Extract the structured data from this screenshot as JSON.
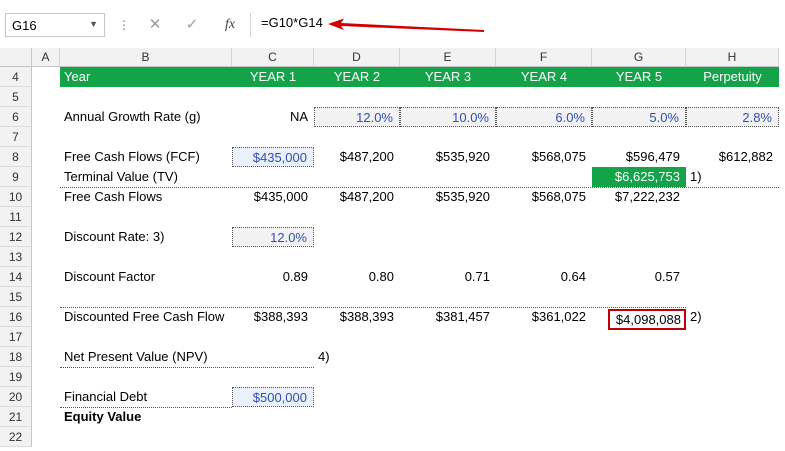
{
  "formula_bar": {
    "name_box": "G16",
    "cancel_icon": "✕",
    "enter_icon": "✓",
    "fx_label": "fx",
    "formula": "=G10*G14"
  },
  "columns": [
    "A",
    "B",
    "C",
    "D",
    "E",
    "F",
    "G",
    "H"
  ],
  "rows": [
    "4",
    "5",
    "6",
    "7",
    "8",
    "9",
    "10",
    "11",
    "12",
    "13",
    "14",
    "15",
    "16",
    "17",
    "18",
    "19",
    "20",
    "21",
    "22"
  ],
  "sheet": {
    "r4": {
      "b": "Year",
      "c": "YEAR 1",
      "d": "YEAR 2",
      "e": "YEAR 3",
      "f": "YEAR 4",
      "g": "YEAR 5",
      "h": "Perpetuity"
    },
    "r6": {
      "b": "Annual Growth Rate (g)",
      "c": "NA",
      "d": "12.0%",
      "e": "10.0%",
      "f": "6.0%",
      "g": "5.0%",
      "h": "2.8%"
    },
    "r8": {
      "b": "Free Cash Flows (FCF)",
      "c": "$435,000",
      "d": "$487,200",
      "e": "$535,920",
      "f": "$568,075",
      "g": "$596,479",
      "h": "$612,882"
    },
    "r9": {
      "b": "Terminal Value (TV)",
      "g": "$6,625,753",
      "note": "1)"
    },
    "r10": {
      "b": "Free Cash Flows",
      "c": "$435,000",
      "d": "$487,200",
      "e": "$535,920",
      "f": "$568,075",
      "g": "$7,222,232"
    },
    "r12": {
      "b": "Discount Rate: 3)",
      "c": "12.0%"
    },
    "r14": {
      "b": "Discount Factor",
      "c": "0.89",
      "d": "0.80",
      "e": "0.71",
      "f": "0.64",
      "g": "0.57"
    },
    "r16": {
      "b": "Discounted Free Cash Flow",
      "c": "$388,393",
      "d": "$388,393",
      "e": "$381,457",
      "f": "$361,022",
      "g": "$4,098,088",
      "note": "2)"
    },
    "r18": {
      "b": "Net Present Value (NPV)",
      "note": "4)"
    },
    "r20": {
      "b": "Financial Debt",
      "c": "$500,000"
    },
    "r21": {
      "b": "Equity Value"
    }
  },
  "colors": {
    "header_green": "#15a34a",
    "input_blue": "#2f4fb4",
    "highlight_red": "#c00000"
  }
}
